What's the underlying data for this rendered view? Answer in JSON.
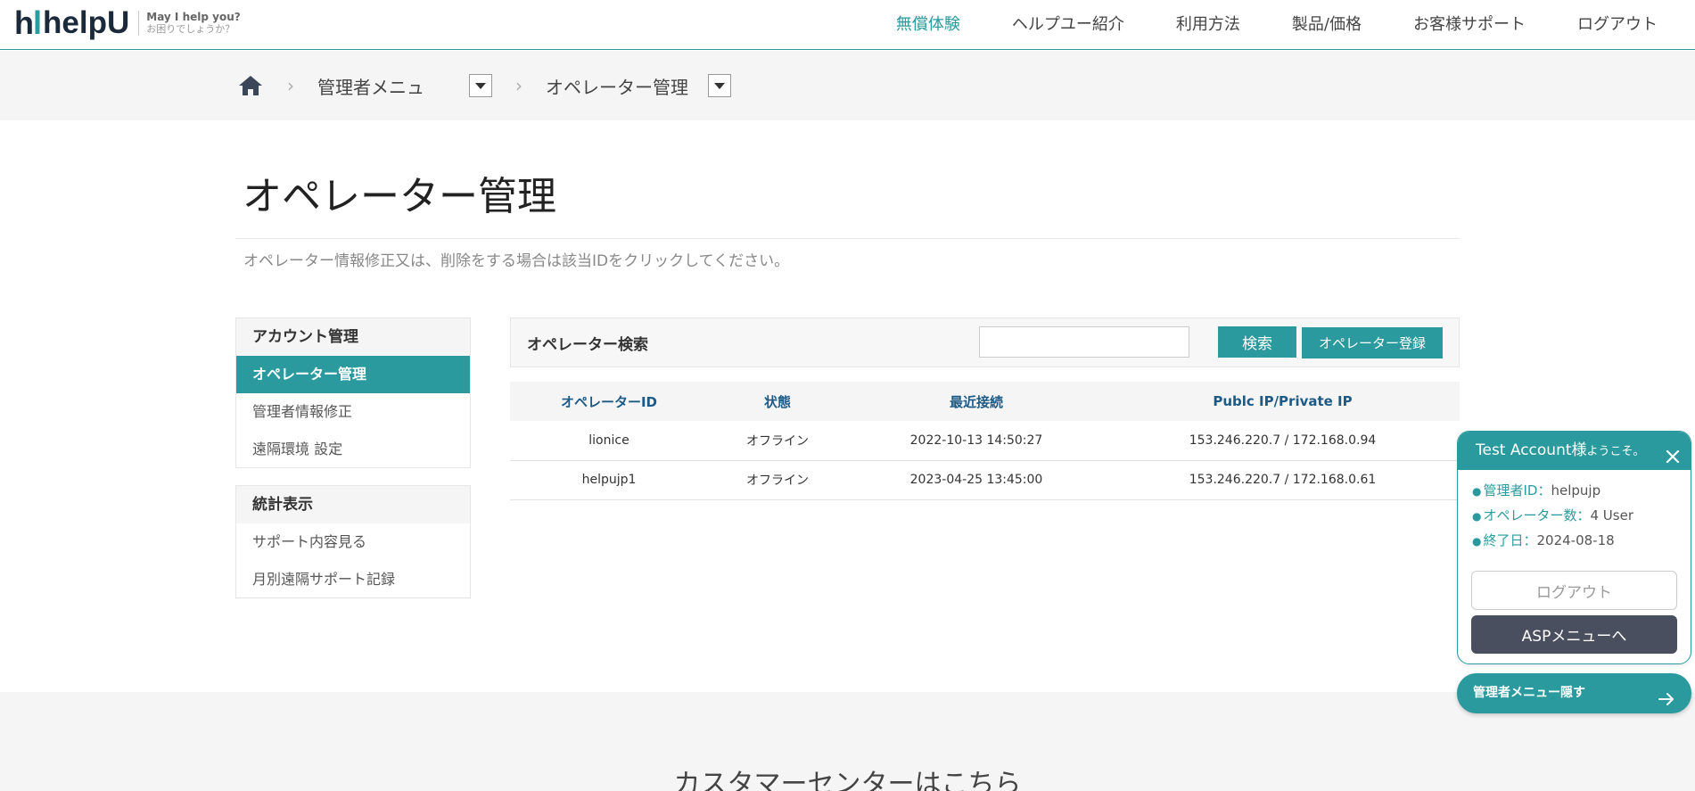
{
  "header": {
    "logo_mark_h": "h",
    "logo_mark_i": "l",
    "logo_word": "helpU",
    "tagline1": "May I help you?",
    "tagline2": "お困りでしょうか？",
    "nav": [
      "無償体験",
      "ヘルプユー紹介",
      "利用方法",
      "製品/価格",
      "お客様サポート",
      "ログアウト"
    ]
  },
  "breadcrumb": {
    "sep": "›",
    "item1": "管理者メニュ",
    "item2": "オペレーター管理"
  },
  "page": {
    "title": "オペレーター管理",
    "description": "オペレーター情報修正又は、削除をする場合は該当IDをクリックしてください。"
  },
  "sidebar": {
    "group1": {
      "heading": "アカウント管理",
      "items": [
        "オペレーター管理",
        "管理者情報修正",
        "遠隔環境 設定"
      ]
    },
    "group2": {
      "heading": "統計表示",
      "items": [
        "サポート内容見る",
        "月別遠隔サポート記録"
      ]
    }
  },
  "search": {
    "label": "オペレーター検索",
    "value": "",
    "button": "検索",
    "register_button": "オペレーター登録"
  },
  "table": {
    "columns": [
      "オペレーターID",
      "状態",
      "最近接続",
      "Publc IP/Private IP"
    ],
    "rows": [
      [
        "lionice",
        "オフライン",
        "2022-10-13 14:50:27",
        "153.246.220.7 / 172.168.0.94"
      ],
      [
        "helpujp1",
        "オフライン",
        "2023-04-25 13:45:00",
        "153.246.220.7 / 172.168.0.61"
      ]
    ]
  },
  "footer": {
    "title": "カスタマーセンターはこちら"
  },
  "admin_popup": {
    "greeting": "Test Account様",
    "greeting_suffix": "ようこそ。",
    "bullet": "●",
    "lines": [
      {
        "key": "管理者ID：",
        "value": "helpujp"
      },
      {
        "key": "オペレーター数：",
        "value": "4 User"
      },
      {
        "key": "終了日：",
        "value": "2024-08-18"
      }
    ],
    "logout_button": "ログアウト",
    "asp_button": "ASPメニューへ",
    "hide_button": "管理者メニュー隠す"
  },
  "colors": {
    "accent": "#2a9a9e",
    "dark_button": "#4a4f60",
    "table_header_text": "#1d5a86"
  }
}
